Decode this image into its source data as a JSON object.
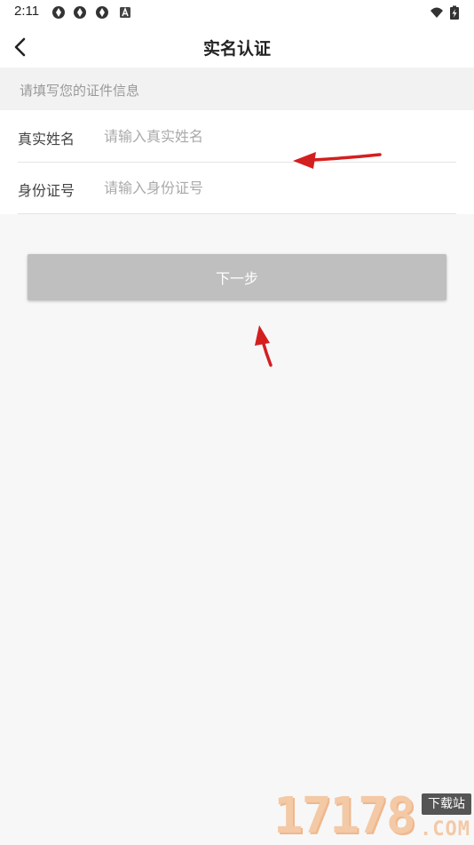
{
  "status_bar": {
    "time": "2:11",
    "icons": [
      "aperture-icon",
      "aperture-icon",
      "aperture-icon",
      "a-badge-icon",
      "wifi-icon",
      "battery-charging-icon"
    ]
  },
  "nav": {
    "title": "实名认证",
    "back_icon": "chevron-left-icon"
  },
  "form": {
    "section_header": "请填写您的证件信息",
    "fields": [
      {
        "label": "真实姓名",
        "placeholder": "请输入真实姓名",
        "value": ""
      },
      {
        "label": "身份证号",
        "placeholder": "请输入身份证号",
        "value": ""
      }
    ]
  },
  "actions": {
    "next_label": "下一步",
    "button_color": "#bfbfbf"
  },
  "annotations": {
    "arrow_color": "#d41f1f"
  },
  "watermark": {
    "digits": "17178",
    "badge": "下载站",
    "suffix": ".COM"
  }
}
